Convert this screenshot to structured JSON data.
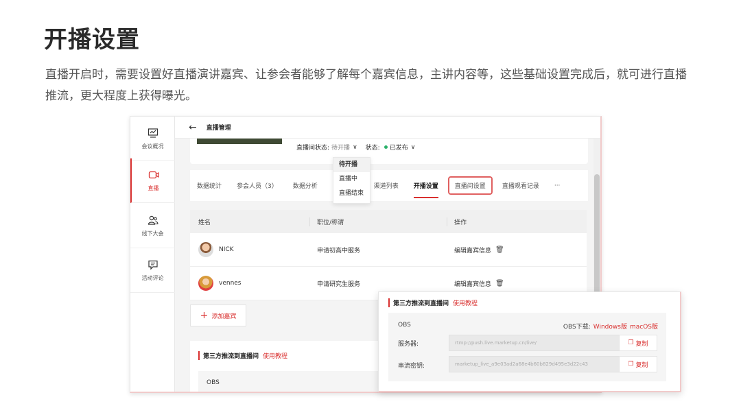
{
  "title": "开播设置",
  "description": "直播开启时，需要设置好直播演讲嘉宾、让参会者能够了解每个嘉宾信息，主讲内容等，这些基础设置完成后，就可进行直播推流，更大程度上获得曝光。",
  "app": {
    "sidebar": [
      {
        "label": "会议概况",
        "icon": "chart-monitor-icon"
      },
      {
        "label": "直播",
        "icon": "video-icon"
      },
      {
        "label": "线下大会",
        "icon": "people-icon"
      },
      {
        "label": "活动评论",
        "icon": "comment-icon"
      }
    ],
    "topbar": {
      "back": "←",
      "title": "直播管理"
    },
    "status": {
      "room_label": "直播间状态:",
      "room_value": "待开播",
      "caret": "∨",
      "state_label": "状态:",
      "state_value": "已发布"
    },
    "dropdown": [
      "待开播",
      "直播中",
      "直播结束"
    ],
    "tabs": [
      "数据统计",
      "参会人员（3）",
      "数据分析",
      "渠道列表",
      "开播设置",
      "直播间设置",
      "直播观看记录",
      "···"
    ],
    "table": {
      "headers": [
        "姓名",
        "职位/称谓",
        "操作"
      ],
      "rows": [
        {
          "name": "NICK",
          "title": "申请初高中服务",
          "action": "编辑嘉宾信息"
        },
        {
          "name": "vennes",
          "title": "申请研究生服务",
          "action": "编辑嘉宾信息"
        }
      ]
    },
    "add_guest": "添加嘉宾",
    "push": {
      "heading": "第三方推流到直播间",
      "tutorial": "使用教程",
      "obs": "OBS"
    }
  },
  "overlay": {
    "heading": "第三方推流到直播间",
    "tutorial": "使用教程",
    "obs": "OBS",
    "download_label": "OBS下载:",
    "windows": "Windows版",
    "mac": "macOS版",
    "server_label": "服务器:",
    "server_value": "rtmp://push.live.marketup.cn/live/",
    "key_label": "串流密钥:",
    "key_value": "marketup_live_a9e03ad2a68e4b60b829d495e3d22c43",
    "copy": "复制"
  },
  "colors": {
    "accent": "#d9302f",
    "status_green": "#2ab16a"
  }
}
